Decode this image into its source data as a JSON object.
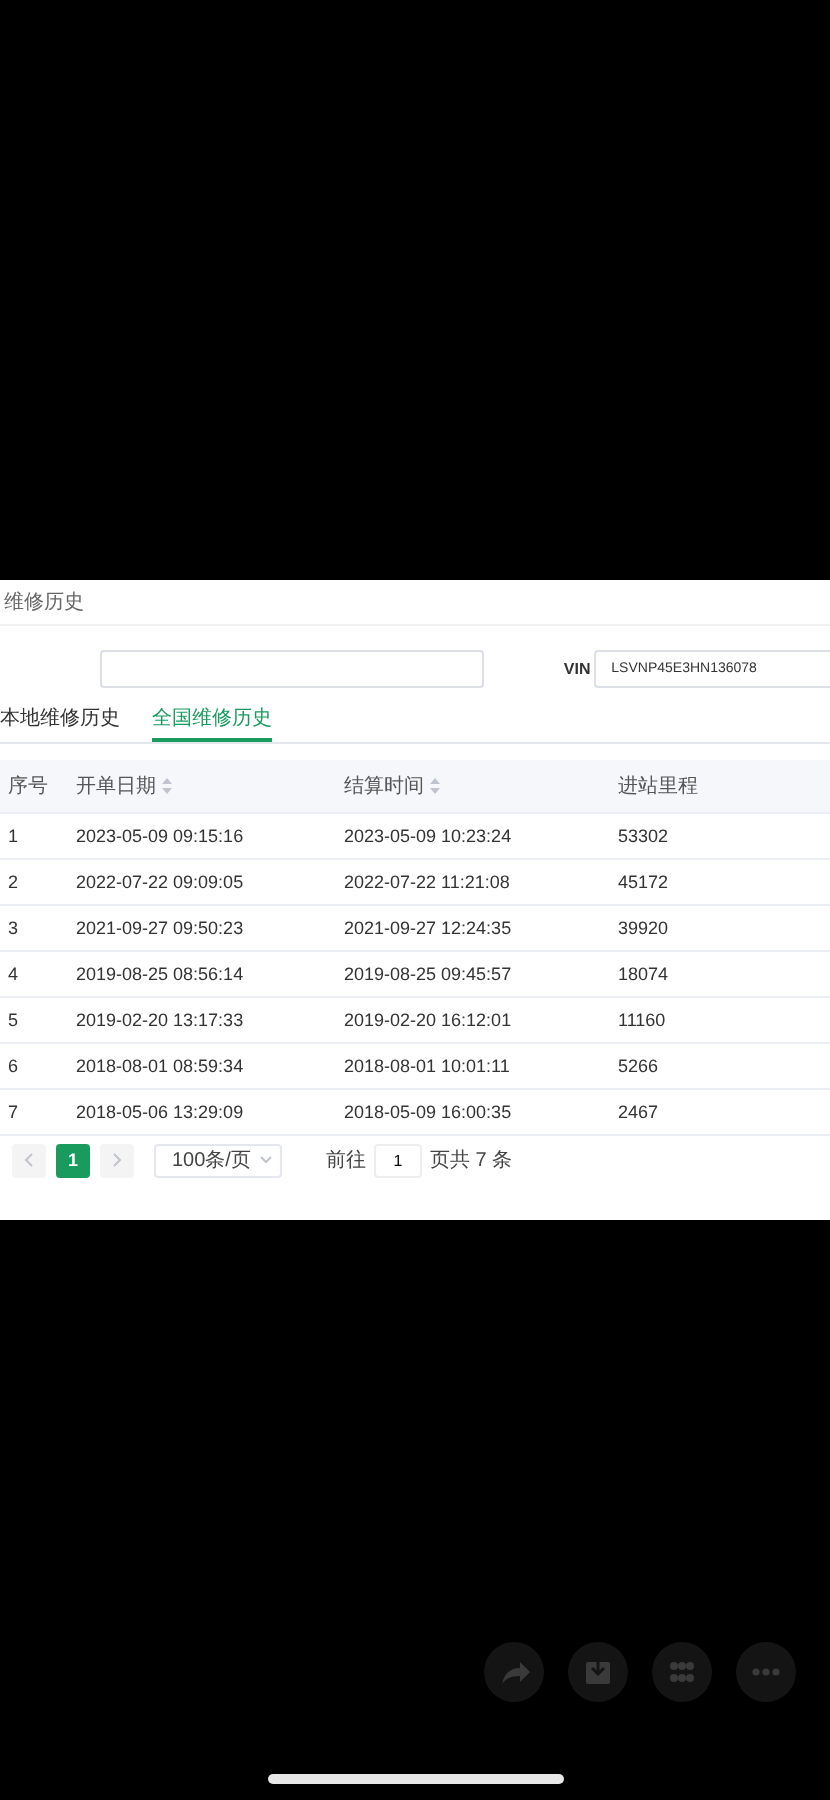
{
  "page": {
    "title": "维修历史"
  },
  "search": {
    "vin_label": "VIN",
    "vin_value": "LSVNP45E3HN136078"
  },
  "tabs": [
    {
      "label": "本地维修历史",
      "selected": false
    },
    {
      "label": "全国维修历史",
      "selected": true
    }
  ],
  "table": {
    "columns": [
      {
        "label": "序号",
        "sortable": false
      },
      {
        "label": "开单日期",
        "sortable": true
      },
      {
        "label": "结算时间",
        "sortable": true
      },
      {
        "label": "进站里程",
        "sortable": false
      }
    ],
    "rows": [
      [
        "1",
        "2023-05-09 09:15:16",
        "2023-05-09 10:23:24",
        "53302"
      ],
      [
        "2",
        "2022-07-22 09:09:05",
        "2022-07-22 11:21:08",
        "45172"
      ],
      [
        "3",
        "2021-09-27 09:50:23",
        "2021-09-27 12:24:35",
        "39920"
      ],
      [
        "4",
        "2019-08-25 08:56:14",
        "2019-08-25 09:45:57",
        "18074"
      ],
      [
        "5",
        "2019-02-20 13:17:33",
        "2019-02-20 16:12:01",
        "11160"
      ],
      [
        "6",
        "2018-08-01 08:59:34",
        "2018-08-01 10:01:11",
        "5266"
      ],
      [
        "7",
        "2018-05-06 13:29:09",
        "2018-05-09 16:00:35",
        "2467"
      ]
    ]
  },
  "pagination": {
    "pages": [
      {
        "label": "1",
        "selected": true
      }
    ],
    "page_size": "100条/页",
    "goto_label": "前往",
    "goto_value": "1",
    "total": "页共 7 条"
  }
}
